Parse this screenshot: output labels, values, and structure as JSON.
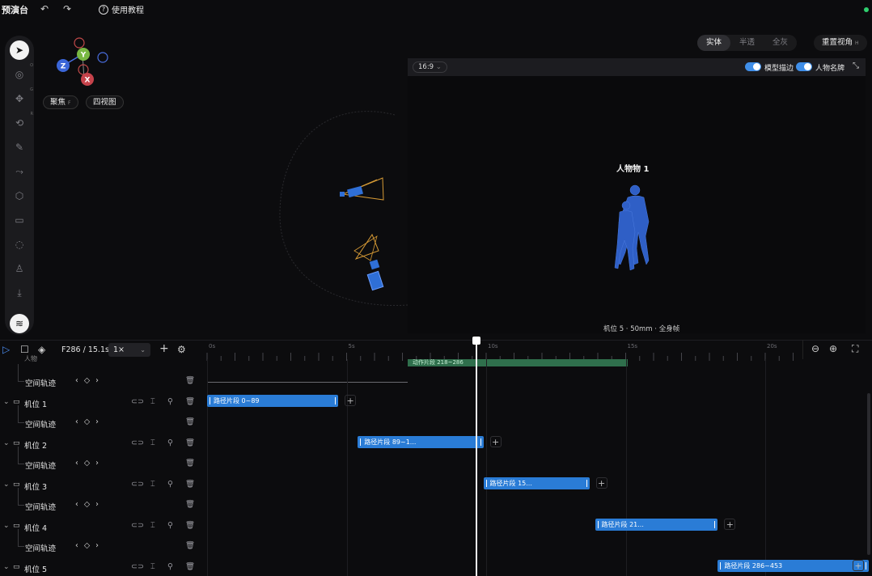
{
  "app": {
    "title": "预演台",
    "undo_icon": "undo-icon",
    "redo_icon": "redo-icon",
    "help_label": "使用教程",
    "status_color": "#2fd06e"
  },
  "toolbar": {
    "tools": [
      {
        "name": "select",
        "glyph": "➤",
        "active": true
      },
      {
        "name": "orbit",
        "glyph": "◎",
        "hint": "O"
      },
      {
        "name": "move",
        "glyph": "✥",
        "hint": "G"
      },
      {
        "name": "rotate",
        "glyph": "⟲",
        "hint": "R"
      },
      {
        "name": "pen",
        "glyph": "✎"
      },
      {
        "name": "path",
        "glyph": "⤳"
      },
      {
        "name": "cube",
        "glyph": "⬡"
      },
      {
        "name": "camera",
        "glyph": "▭"
      },
      {
        "name": "light",
        "glyph": "◌"
      },
      {
        "name": "character",
        "glyph": "♙"
      },
      {
        "name": "import",
        "glyph": "⤓"
      }
    ],
    "settings_glyph": "≋"
  },
  "gizmo": {
    "axis_y": "Y",
    "axis_z": "Z",
    "axis_x": "X",
    "focus_label": "聚焦",
    "focus_hint": "F",
    "fourview_label": "四视图"
  },
  "render_tabs": [
    {
      "label": "实体",
      "active": true
    },
    {
      "label": "半透",
      "active": false
    },
    {
      "label": "全灰",
      "active": false
    }
  ],
  "reset_view_label": "重置视角",
  "reset_view_hint": "H",
  "preview": {
    "ratio": "16:9",
    "toggle_outline_label": "模型描边",
    "toggle_nameplate_label": "人物名牌",
    "character_label": "人物物 1",
    "camera_info": "机位 5 · 50mm · 全身帧"
  },
  "timeline": {
    "frame_readout": "F286 / 15.1s",
    "speed": "1×",
    "ticks": [
      {
        "label": "0s",
        "t": 0
      },
      {
        "label": "5s",
        "t": 5
      },
      {
        "label": "10s",
        "t": 10
      },
      {
        "label": "15s",
        "t": 15
      },
      {
        "label": "20s",
        "t": 20
      }
    ],
    "playhead_time": 15.1,
    "top_row_label": "人物",
    "green_clip_label": "动作片段 218~286",
    "tracks": [
      {
        "kind": "sub",
        "label": "空间轨迹",
        "nav": "‹ ◇ ›"
      },
      {
        "kind": "camera",
        "label": "机位 1"
      },
      {
        "kind": "sub",
        "label": "空间轨迹",
        "nav": "‹ ◇ ›"
      },
      {
        "kind": "camera",
        "label": "机位 2"
      },
      {
        "kind": "sub",
        "label": "空间轨迹",
        "nav": "‹ ◇ ›"
      },
      {
        "kind": "camera",
        "label": "机位 3"
      },
      {
        "kind": "sub",
        "label": "空间轨迹",
        "nav": "‹ ◇ ›"
      },
      {
        "kind": "camera",
        "label": "机位 4"
      },
      {
        "kind": "sub",
        "label": "空间轨迹",
        "nav": "‹ ◇ ›"
      },
      {
        "kind": "camera",
        "label": "机位 5"
      }
    ],
    "clips": [
      {
        "label": "路径片段 0~89",
        "row": 1,
        "start": 0,
        "end": 4.7
      },
      {
        "label": "路径片段 89~1...",
        "row": 3,
        "start": 5.4,
        "end": 9.9
      },
      {
        "label": "路径片段 15...",
        "row": 5,
        "start": 9.9,
        "end": 13.7
      },
      {
        "label": "路径片段 21...",
        "row": 7,
        "start": 13.9,
        "end": 18.3
      },
      {
        "label": "路径片段 286~453",
        "row": 9,
        "start": 18.3,
        "end": 29.7
      }
    ]
  },
  "colors": {
    "accent_blue": "#2a7cd6",
    "green_clip": "#2f6f4c",
    "frustum": "#d69a35",
    "camera_body": "#2f6fd6",
    "figure": "#2f5fc6"
  }
}
